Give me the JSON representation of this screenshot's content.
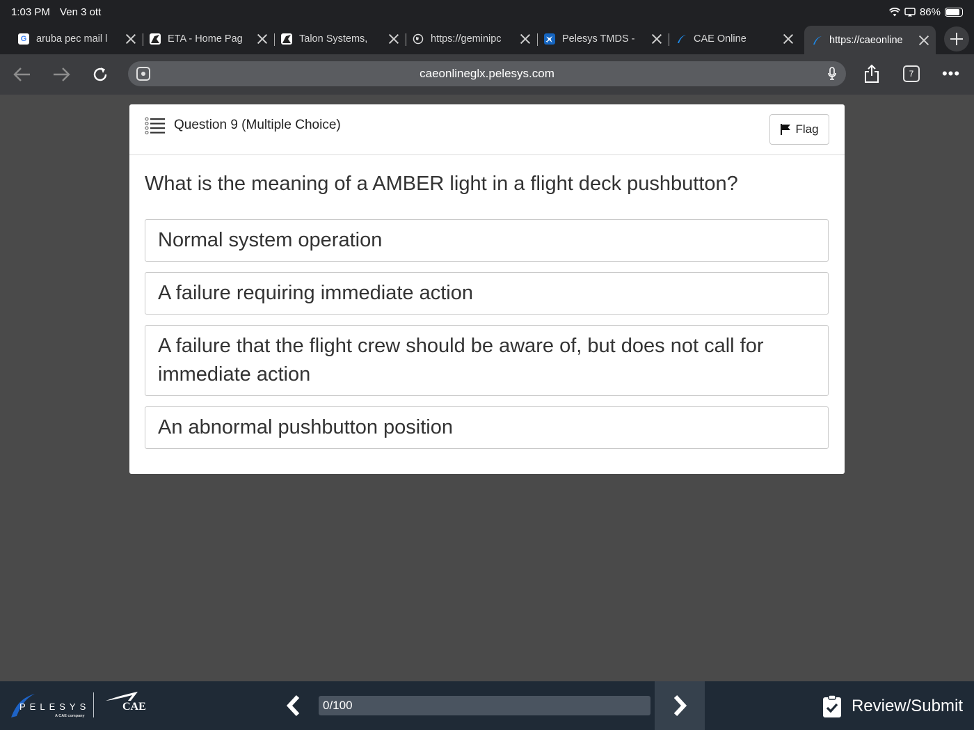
{
  "status": {
    "time": "1:03 PM",
    "date": "Ven 3 ott",
    "battery": "86%",
    "battery_level": 0.86
  },
  "tabs": [
    {
      "title": "aruba pec mail l",
      "icon": "google-g-icon"
    },
    {
      "title": "ETA - Home Pag",
      "icon": "eta-logo-icon"
    },
    {
      "title": "Talon Systems,",
      "icon": "talon-logo-icon"
    },
    {
      "title": "https://geminipc",
      "icon": "globe-icon"
    },
    {
      "title": "Pelesys TMDS -",
      "icon": "plane-icon"
    },
    {
      "title": "CAE Online",
      "icon": "cae-swoosh-icon"
    },
    {
      "title": "https://caeonline",
      "icon": "cae-swoosh-icon"
    }
  ],
  "toolbar": {
    "url": "caeonlineglx.pelesys.com",
    "tab_count": "7"
  },
  "card": {
    "title": "Question 9 (Multiple Choice)",
    "flag_label": "Flag",
    "question": "What is the meaning of a AMBER light in a flight deck pushbutton?",
    "options": [
      "Normal system operation",
      "A failure requiring immediate action",
      "A failure that the flight crew should be aware of, but does not call for immediate action",
      "An abnormal pushbutton position"
    ]
  },
  "footer": {
    "brand_pelesys": "PELESYS",
    "brand_pelesys_sub": "A CAE company",
    "brand_cae": "CAE",
    "progress": "0/100",
    "review_label": "Review/Submit"
  },
  "colors": {
    "page_bg": "#4a4a4a",
    "chrome_dark": "#202124",
    "toolbar": "#3c3d40",
    "footer": "#1f2a36",
    "footer_next": "#36414d"
  }
}
